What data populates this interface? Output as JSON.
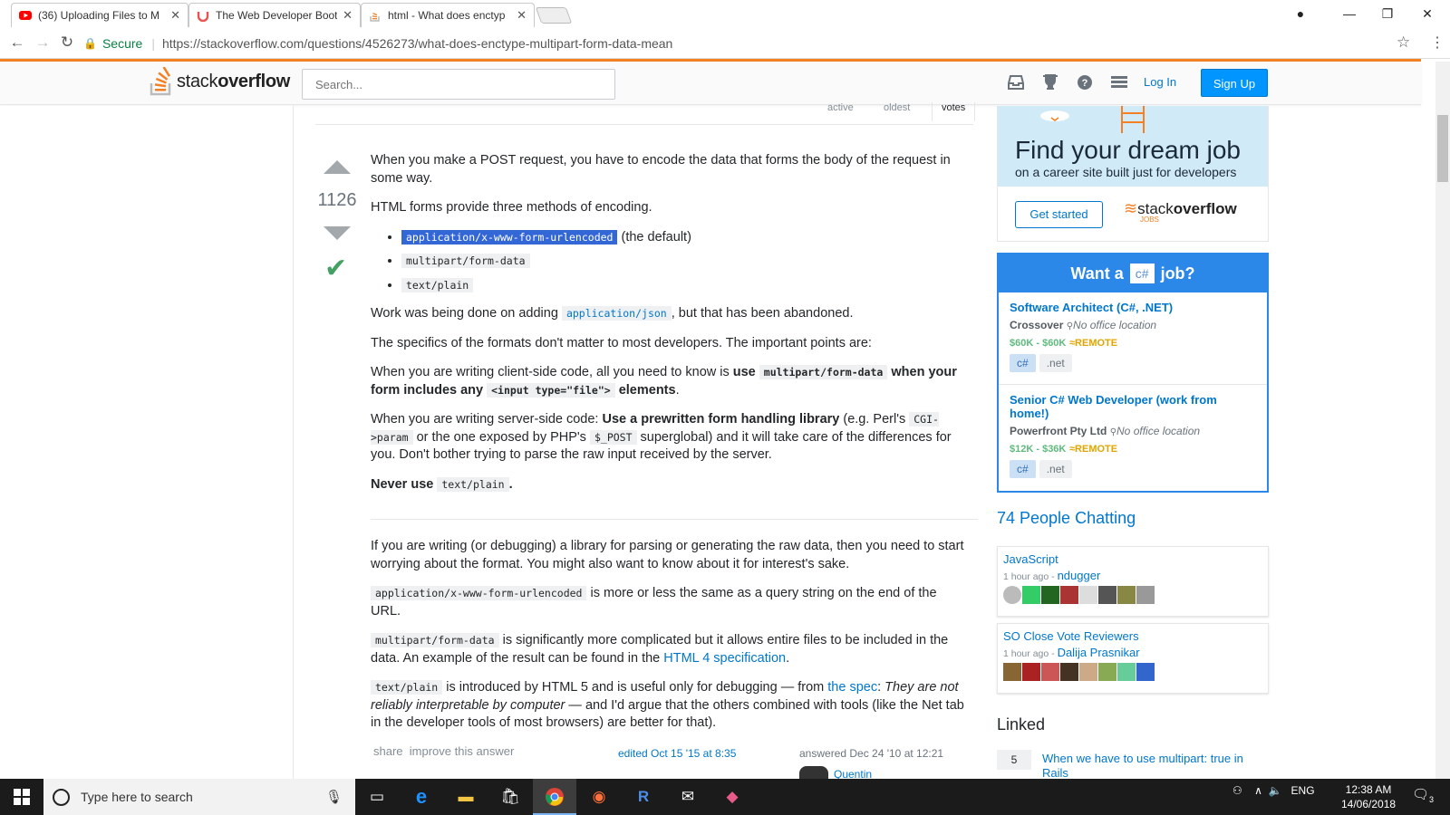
{
  "browser": {
    "tabs": [
      {
        "title": "(36) Uploading Files to M",
        "icon": "youtube-icon",
        "color": "#ff0000"
      },
      {
        "title": "The Web Developer Boot",
        "icon": "udemy-icon",
        "color": "#ec5252"
      },
      {
        "title": "html - What does enctyp",
        "icon": "stackoverflow-icon",
        "color": "#f48024"
      }
    ],
    "secure_label": "Secure",
    "url": "https://stackoverflow.com/questions/4526273/what-does-enctype-multipart-form-data-mean"
  },
  "header": {
    "logo_text_a": "stack",
    "logo_text_b": "overflow",
    "search_placeholder": "Search...",
    "login": "Log In",
    "signup": "Sign Up",
    "icons": [
      "inbox-icon",
      "trophy-icon",
      "help-icon",
      "site-switcher-icon"
    ]
  },
  "answers": {
    "sort_tabs": [
      "active",
      "oldest",
      "votes"
    ],
    "vote_count": "1126",
    "p1": "When you make a POST request, you have to encode the data that forms the body of the request in some way.",
    "p2": "HTML forms provide three methods of encoding.",
    "methods": [
      "application/x-www-form-urlencoded",
      "multipart/form-data",
      "text/plain"
    ],
    "default_note": "(the default)",
    "p3_a": "Work was being done on adding ",
    "p3_code": "application/json",
    "p3_b": ", but that has been abandoned.",
    "p4": "The specifics of the formats don't matter to most developers. The important points are:",
    "p5_a": "When you are writing client-side code, all you need to know is ",
    "p5_b": "use ",
    "p5_code1": "multipart/form-data",
    "p5_c": " when your form includes any ",
    "p5_code2": "<input type=\"file\">",
    "p5_d": " elements",
    "p5_e": ".",
    "p6_a": "When you are writing server-side code: ",
    "p6_b": "Use a prewritten form handling library",
    "p6_c": " (e.g. Perl's ",
    "p6_code1": "CGI->param",
    "p6_d": " or the one exposed by PHP's ",
    "p6_code2": "$_POST",
    "p6_e": " superglobal) and it will take care of the differences for you. Don't bother trying to parse the raw input received by the server.",
    "p7_a": "Never use ",
    "p7_code": "text/plain",
    "p7_b": ".",
    "q1": "If you are writing (or debugging) a library for parsing or generating the raw data, then you need to start worrying about the format. You might also want to know about it for interest's sake.",
    "q2_code": "application/x-www-form-urlencoded",
    "q2": " is more or less the same as a query string on the end of the URL.",
    "q3_code": "multipart/form-data",
    "q3_a": " is significantly more complicated but it allows entire files to be included in the data. An example of the result can be found in the ",
    "q3_link": "HTML 4 specification",
    "q3_b": ".",
    "q4_code": "text/plain",
    "q4_a": " is introduced by HTML 5 and is useful only for debugging — from ",
    "q4_link": "the spec",
    "q4_b": ": ",
    "q4_quote": "They are not reliably interpretable by computer",
    "q4_c": " — and I'd argue that the others combined with tools (like the Net tab in the developer tools of most browsers) are better for that).",
    "share": "share",
    "improve": "improve this answer",
    "edited": "edited Oct 15 '15 at 8:35",
    "answered": "answered Dec 24 '10 at 12:21",
    "author": "Quentin"
  },
  "sidebar": {
    "ad_title": "Find your dream job",
    "ad_sub": "on a career site built just for developers",
    "ad_button": "Get started",
    "ad_brand_a": "stack",
    "ad_brand_b": "overflow",
    "ad_brand_c": "JOBS",
    "want_a": "Want a",
    "want_tag": "c#",
    "want_b": "job?",
    "jobs": [
      {
        "title": "Software Architect (C#, .NET)",
        "company": "Crossover",
        "location": "No office location",
        "salary": "$60K - $60K",
        "remote": "REMOTE",
        "tags": [
          "c#",
          ".net"
        ]
      },
      {
        "title": "Senior C# Web Developer (work from home!)",
        "company": "Powerfront Pty Ltd",
        "location": "No office location",
        "salary": "$12K - $36K",
        "remote": "REMOTE",
        "tags": [
          "c#",
          ".net"
        ]
      }
    ],
    "chatting": "74 People Chatting",
    "rooms": [
      {
        "name": "JavaScript",
        "time": "1 hour ago",
        "user": "ndugger"
      },
      {
        "name": "SO Close Vote Reviewers",
        "time": "1 hour ago",
        "user": "Dalija Prasnikar"
      }
    ],
    "linked_title": "Linked",
    "linked_count": "5",
    "linked_question": "When we have to use multipart: true in Rails"
  },
  "taskbar": {
    "search_placeholder": "Type here to search",
    "lang": "ENG",
    "time": "12:38 AM",
    "date": "14/06/2018",
    "notif_count": "3"
  }
}
